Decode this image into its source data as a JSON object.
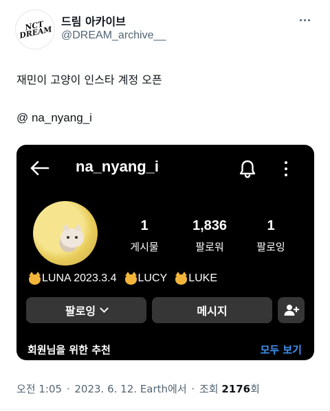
{
  "author": {
    "display_name": "드림 아카이브",
    "handle": "@DREAM_archive__",
    "avatar_logo_text": "NCT DREAM"
  },
  "tweet": {
    "line1": "재민이 고양이 인스타 계정 오픈",
    "line2": "@ na_nyang_i"
  },
  "instagram": {
    "username": "na_nyang_i",
    "stats": [
      {
        "value": "1",
        "label": "게시물"
      },
      {
        "value": "1,836",
        "label": "팔로워"
      },
      {
        "value": "1",
        "label": "팔로잉"
      }
    ],
    "bio": {
      "part1": "LUNA 2023.3.4",
      "part2": "LUCY",
      "part3": "LUKE"
    },
    "follow_button": "팔로잉",
    "message_button": "메시지",
    "recommend_title": "회원님을 위한 추천",
    "see_all": "모두 보기"
  },
  "meta": {
    "time": "오전 1:05",
    "date": "2023. 6. 12.",
    "source": "Earth에서",
    "views_label": "조회",
    "views_count": "2176",
    "views_suffix": "회"
  },
  "colors": {
    "link_blue": "#3d94f6",
    "card_bg": "#000000",
    "button_bg": "#363636",
    "muted_text": "#536471"
  },
  "icons": [
    "more-icon",
    "back-arrow-icon",
    "bell-icon",
    "kebab-icon",
    "chevron-down-icon",
    "add-user-icon",
    "cat-emoji-icon"
  ]
}
